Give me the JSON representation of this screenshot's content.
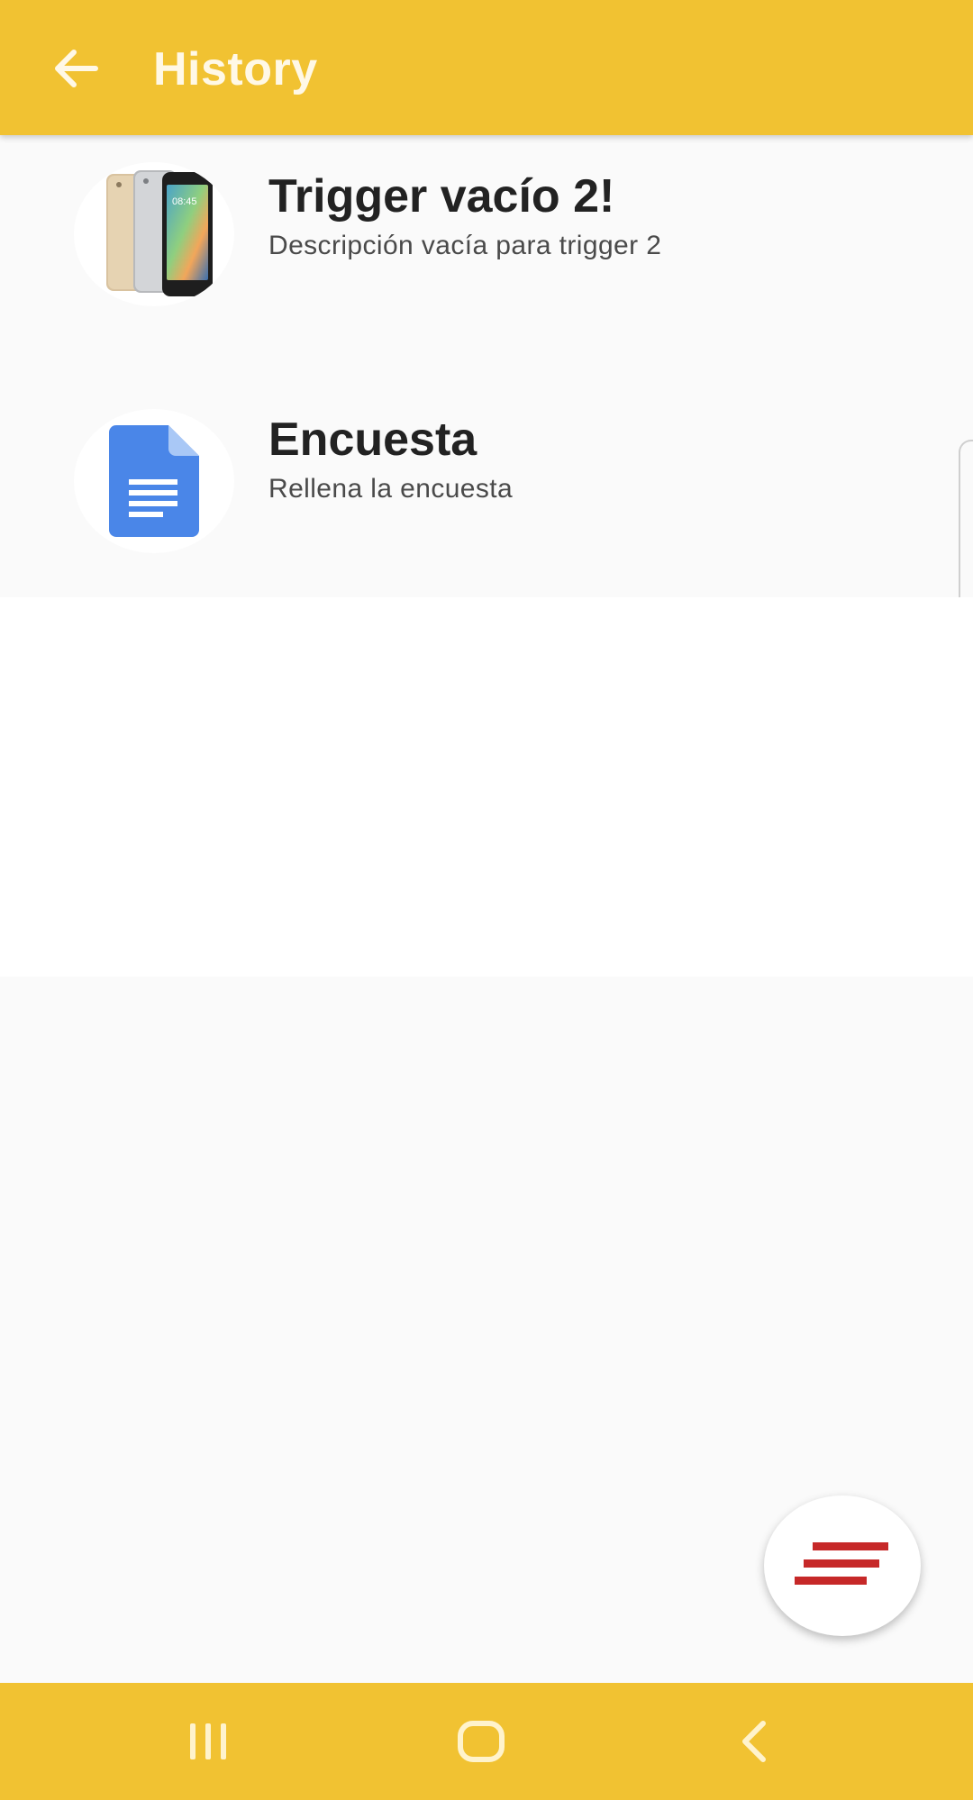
{
  "app_bar": {
    "title": "History",
    "back_icon": "arrow-back-icon",
    "background_color": "#f1c232"
  },
  "history_items": [
    {
      "title": "Trigger vacío 2!",
      "subtitle": "Descripción vacía para trigger 2",
      "icon": "smartphones-image"
    },
    {
      "title": "Encuesta",
      "subtitle": "Rellena la encuesta",
      "icon": "google-docs-icon"
    }
  ],
  "fab": {
    "icon": "menu-lines-icon",
    "icon_color": "#c62828"
  },
  "nav_bar": {
    "buttons": [
      "recent-apps-icon",
      "home-icon",
      "back-icon"
    ],
    "background_color": "#f1c232"
  }
}
